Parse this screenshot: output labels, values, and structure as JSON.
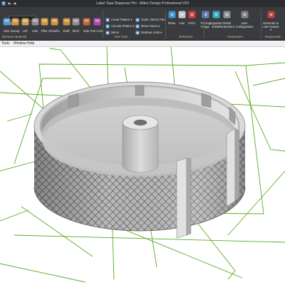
{
  "window": {
    "title": "Label Tape Dispenser Pin - Alibre Design Professional V24"
  },
  "search": {
    "placeholder": "",
    "value": ""
  },
  "ribbon": {
    "tools_large": [
      {
        "id": "view",
        "label": "view",
        "icon": "view-icon",
        "color": "#5aa3e0"
      },
      {
        "id": "sweep",
        "label": "Sweep",
        "icon": "sweep-icon",
        "color": "#e0a040"
      },
      {
        "id": "loft",
        "label": "Loft",
        "icon": "loft-icon",
        "color": "#d8b050"
      },
      {
        "id": "hole",
        "label": "Hole",
        "icon": "hole-icon",
        "color": "#9a9a9a"
      },
      {
        "id": "fillet",
        "label": "Fillet",
        "icon": "fillet-icon",
        "color": "#e0a040"
      },
      {
        "id": "chamfer",
        "label": "Chamfer",
        "icon": "chamfer-icon",
        "color": "#e0a040"
      },
      {
        "id": "draft",
        "label": "Draft",
        "icon": "draft-icon",
        "color": "#d89a3a"
      },
      {
        "id": "shell",
        "label": "Shell",
        "icon": "shell-icon",
        "color": "#9a9a9a"
      },
      {
        "id": "rule",
        "label": "Rule",
        "icon": "rule-icon",
        "color": "#d06a3a"
      },
      {
        "id": "part-color",
        "label": "Part Color",
        "icon": "part-color-icon",
        "color": "#c04ac0"
      }
    ],
    "tools_small_col1": [
      {
        "id": "linear-pattern",
        "label": "Linear Pattern ▾",
        "icon": "linear-pattern-icon"
      },
      {
        "id": "circular-pattern",
        "label": "Circular Pattern ▾",
        "icon": "circular-pattern-icon"
      },
      {
        "id": "mirror",
        "label": "Mirror",
        "icon": "mirror-icon"
      }
    ],
    "tools_small_col2": [
      {
        "id": "scale-mirror",
        "label": "Scale | Mirror Part",
        "icon": "scale-icon"
      },
      {
        "id": "move-faces",
        "label": "Move Faces ▾",
        "icon": "move-faces-icon"
      },
      {
        "id": "boolean",
        "label": "Boolean Units ▾",
        "icon": "boolean-icon"
      }
    ],
    "tools_large_right": [
      {
        "id": "plane",
        "label": "Plane",
        "icon": "plane-icon",
        "color": "#3aa0e0"
      },
      {
        "id": "axis",
        "label": "Axis",
        "icon": "axis-icon",
        "color": "#d8d8d8"
      },
      {
        "id": "point",
        "label": "Point",
        "icon": "point-icon",
        "color": "#e04040"
      },
      {
        "id": "tracing-image",
        "label": "Tracing Image",
        "icon": "tracing-image-icon",
        "color": "#6a8ad0"
      },
      {
        "id": "equation-editor",
        "label": "Equation Editor",
        "icon": "equation-editor-icon",
        "color": "#3ab8d0"
      },
      {
        "id": "global-parameters",
        "label": "Global Parameters",
        "icon": "global-parameters-icon",
        "color": "#9a9a9a"
      },
      {
        "id": "new-configuration",
        "label": "New Configuration",
        "icon": "new-configuration-icon",
        "color": "#8a8a8a"
      },
      {
        "id": "generate-feature",
        "label": "Generate to Last Feature ▾",
        "icon": "generate-feature-icon",
        "color": "#d04040"
      }
    ],
    "group_labels": {
      "remove_material": "(Remove Material)",
      "part_tools": "Part Tools",
      "reference": "Reference",
      "parameters": "Parameters",
      "regenerate": "Regenerate"
    }
  },
  "menubar": {
    "items": [
      "Tools",
      "Window",
      "Help"
    ]
  },
  "viewport": {
    "model": "knurled-cylindrical-spool",
    "colors": {
      "background": "#ffffff",
      "reference_lines": "#5aaa22",
      "model_light": "#d6d6d6",
      "model_dark": "#8a8a8a",
      "knurl": "#4a4a4a"
    }
  }
}
